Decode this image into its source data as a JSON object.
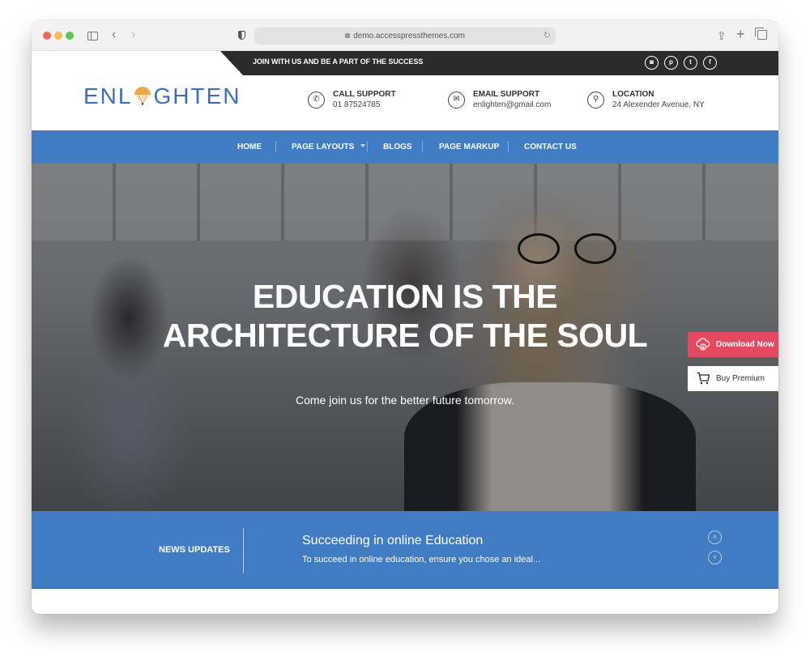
{
  "browser": {
    "url": "demo.accesspressthemes.com",
    "icons": [
      "sidebar-icon",
      "back-icon",
      "forward-icon",
      "shield-icon",
      "lock-icon",
      "reload-icon",
      "share-icon",
      "new-tab-icon",
      "tabs-overview-icon"
    ]
  },
  "topbar": {
    "tagline": "JOIN WITH US AND BE A PART OF THE SUCCESS",
    "social": [
      {
        "name": "instagram-icon",
        "glyph": "◙"
      },
      {
        "name": "pinterest-icon",
        "glyph": "p"
      },
      {
        "name": "twitter-icon",
        "glyph": "t"
      },
      {
        "name": "facebook-icon",
        "glyph": "f"
      }
    ]
  },
  "header": {
    "logo_left": "ENL",
    "logo_right": "GHTEN",
    "contacts": [
      {
        "icon": "phone-icon",
        "glyph": "✆",
        "title": "CALL SUPPORT",
        "value": "01 87524785"
      },
      {
        "icon": "email-icon",
        "glyph": "✉",
        "title": "EMAIL SUPPORT",
        "value": "enlighten@gmail.com"
      },
      {
        "icon": "location-icon",
        "glyph": "⚲",
        "title": "LOCATION",
        "value": "24 Alexender Avenue, NY"
      }
    ]
  },
  "nav": {
    "items": [
      {
        "label": "HOME"
      },
      {
        "label": "PAGE LAYOUTS",
        "has_dropdown": true
      },
      {
        "label": "BLOGS"
      },
      {
        "label": "PAGE MARKUP"
      },
      {
        "label": "CONTACT US"
      }
    ]
  },
  "hero": {
    "title_line1": "EDUCATION IS THE",
    "title_line2": "ARCHITECTURE OF THE SOUL",
    "subtitle": "Come join us for the better future tomorrow."
  },
  "floating": {
    "download_label": "Download Now",
    "buy_label": "Buy Premium",
    "colors": {
      "download": "#e34961"
    }
  },
  "news": {
    "label": "NEWS UPDATES",
    "title": "Succeeding in online Education",
    "excerpt": "To succeed in online education, ensure you chose an ideal...",
    "up_glyph": "˄",
    "down_glyph": "˅"
  },
  "theme": {
    "primary": "#417bc2",
    "dark": "#2b2b2b",
    "logo": "#3b6fb6"
  }
}
